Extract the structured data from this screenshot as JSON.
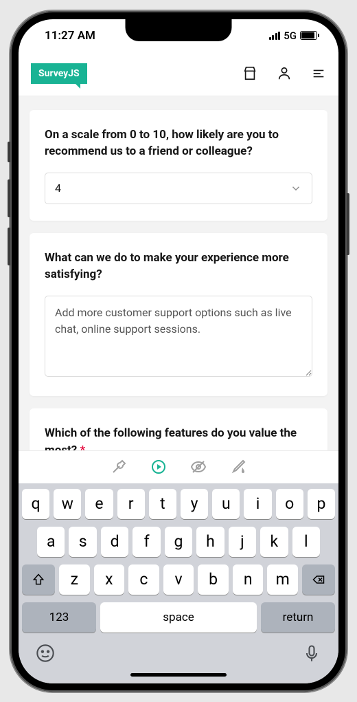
{
  "status": {
    "time": "11:27 AM",
    "network": "5G"
  },
  "header": {
    "logo": "SurveyJS"
  },
  "questions": {
    "q1": {
      "title": "On a scale from 0 to 10, how likely are you to recommend us to a friend or colleague?",
      "value": "4"
    },
    "q2": {
      "title": "What can we do to make your experience more satisfying?",
      "value": "Add more customer support options such as live chat, online support sessions."
    },
    "q3": {
      "title": "Which of the following features do you value the most?",
      "required": "*"
    }
  },
  "keyboard": {
    "row1": [
      "q",
      "w",
      "e",
      "r",
      "t",
      "y",
      "u",
      "i",
      "o",
      "p"
    ],
    "row2": [
      "a",
      "s",
      "d",
      "f",
      "g",
      "h",
      "j",
      "k",
      "l"
    ],
    "row3": [
      "z",
      "x",
      "c",
      "v",
      "b",
      "n",
      "m"
    ],
    "numKey": "123",
    "space": "space",
    "return": "return"
  }
}
